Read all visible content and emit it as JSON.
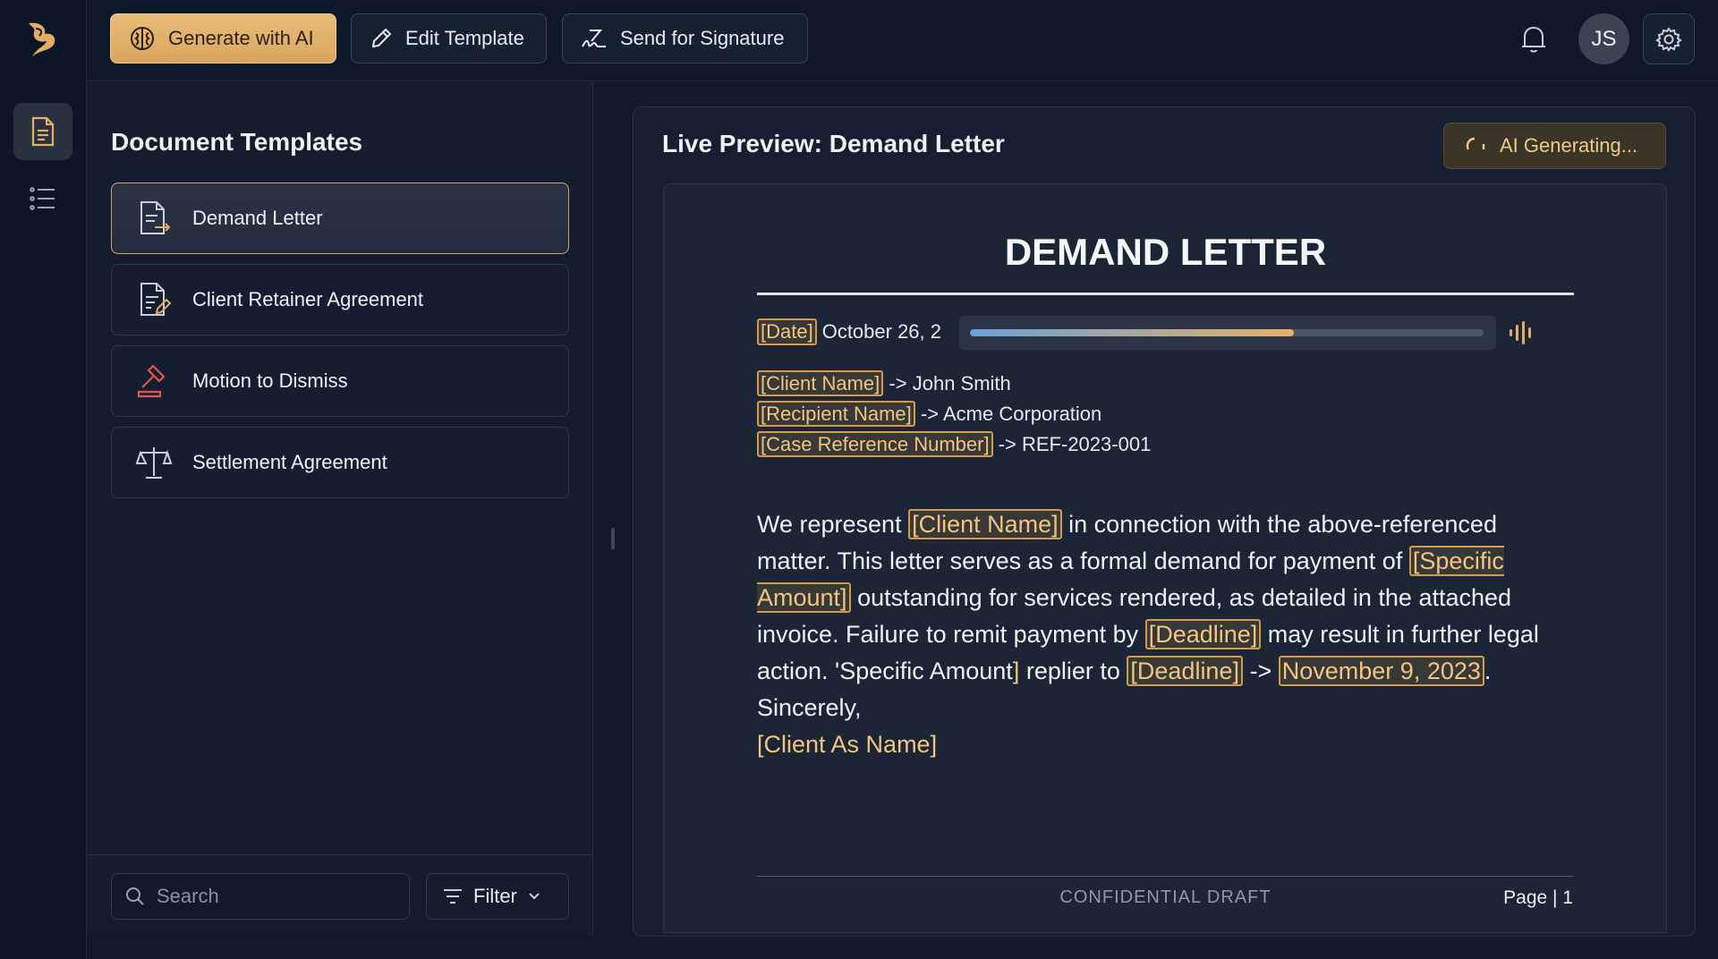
{
  "topbar": {
    "generate_label": "Generate with AI",
    "edit_label": "Edit Template",
    "send_label": "Send for Signature",
    "avatar_initials": "JS"
  },
  "templates": {
    "title": "Document Templates",
    "items": [
      {
        "label": "Demand Letter",
        "icon": "document-arrow-icon",
        "active": true
      },
      {
        "label": "Client Retainer Agreement",
        "icon": "document-pen-icon",
        "active": false
      },
      {
        "label": "Motion to Dismiss",
        "icon": "gavel-icon",
        "active": false
      },
      {
        "label": "Settlement Agreement",
        "icon": "scales-icon",
        "active": false
      }
    ],
    "search_placeholder": "Search",
    "filter_label": "Filter"
  },
  "preview": {
    "title": "Live Preview: Demand Letter",
    "status": "AI Generating...",
    "progress": 0.63,
    "doc": {
      "title": "DEMAND LETTER",
      "date_placeholder": "[Date]",
      "date_value": "October 26, 2",
      "fields": [
        {
          "placeholder": "[Client Name]",
          "arrow": "->",
          "value": "John Smith"
        },
        {
          "placeholder": "[Recipient Name]",
          "arrow": "->",
          "value": "Acme Corporation"
        },
        {
          "placeholder": "[Case Reference Number]",
          "arrow": "->",
          "value": "REF-2023-001"
        }
      ],
      "body": {
        "p1": "We represent ",
        "ph1": "[Client Name]",
        "p2": " in connection with the above-referenced matter. This letter serves as a formal demand for payment of ",
        "ph2": "[Specific Amount]",
        "p3": " outstanding for services rendered, as detailed in the attached invoice. Failure to remit payment by ",
        "ph3": "[Deadline]",
        "p4": " may result in further legal action. 'Specific Amount",
        "ph4_close": "]",
        "p5": " replier to ",
        "ph5": "[Deadline]",
        "p6": " -> ",
        "ph6": "November 9, 2023",
        "p7": ".",
        "closing": "Sincerely,",
        "signature": "[Client As Name]"
      },
      "footer_center": "CONFIDENTIAL DRAFT",
      "footer_page": "Page | 1"
    }
  },
  "colors": {
    "accent": "#d9a55e",
    "background": "#101a2b",
    "panel": "#131d2e"
  }
}
